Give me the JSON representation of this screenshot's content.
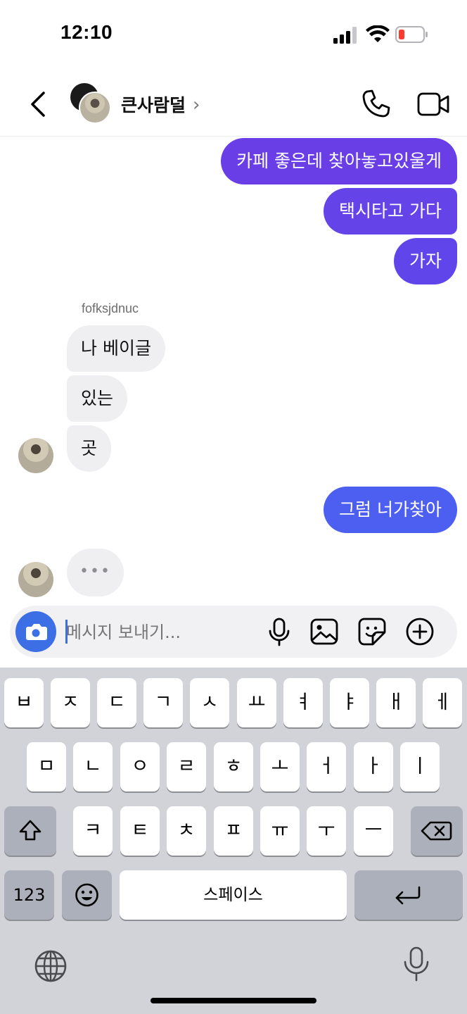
{
  "status_bar": {
    "time": "12:10"
  },
  "header": {
    "title": "큰사람덜",
    "chevron": "›"
  },
  "messages_out_top": [
    {
      "text": "카페 좋은데 찾아놓고있울게"
    },
    {
      "text": "택시타고 가다"
    },
    {
      "text": "가자"
    }
  ],
  "sender": {
    "name": "fofksjdnuc"
  },
  "messages_in": [
    {
      "text": "나 베이글"
    },
    {
      "text": "있는"
    },
    {
      "text": "곳"
    }
  ],
  "message_out_last": {
    "text": "그럼 너가찾아"
  },
  "typing_indicator": {
    "dots": "•••"
  },
  "composer": {
    "placeholder": "메시지 보내기..."
  },
  "keyboard": {
    "row1": [
      "ㅂ",
      "ㅈ",
      "ㄷ",
      "ㄱ",
      "ㅅ",
      "ㅛ",
      "ㅕ",
      "ㅑ",
      "ㅐ",
      "ㅔ"
    ],
    "row2": [
      "ㅁ",
      "ㄴ",
      "ㅇ",
      "ㄹ",
      "ㅎ",
      "ㅗ",
      "ㅓ",
      "ㅏ",
      "ㅣ"
    ],
    "row3": [
      "ㅋ",
      "ㅌ",
      "ㅊ",
      "ㅍ",
      "ㅠ",
      "ㅜ",
      "ㅡ"
    ],
    "numbers_label": "123",
    "space_label": "스페이스"
  },
  "icons": {
    "back": "back-icon",
    "call": "phone-icon",
    "video": "video-camera-icon",
    "camera": "camera-icon",
    "mic": "microphone-icon",
    "gallery": "image-icon",
    "sticker": "sticker-icon",
    "plus": "plus-circle-icon",
    "shift": "shift-icon",
    "delete": "backspace-icon",
    "emoji": "emoji-icon",
    "return": "return-icon",
    "globe": "globe-icon",
    "dictation": "microphone-icon"
  },
  "colors": {
    "bubble_out_1": "#6a3ee6",
    "bubble_out_2": "#6443e8",
    "bubble_out_3": "#6046ea",
    "bubble_out_last": "#4d5ff0",
    "accent": "#3c6ee6"
  }
}
